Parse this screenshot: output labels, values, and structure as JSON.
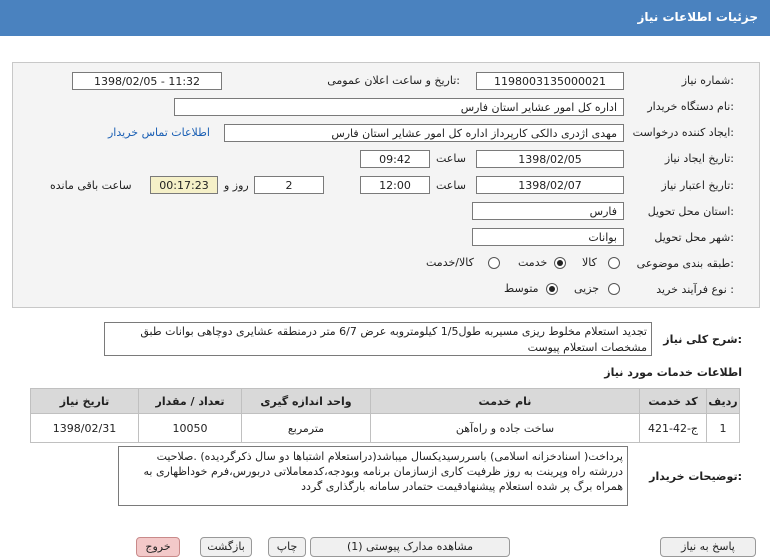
{
  "header": {
    "title": "جزئیات اطلاعات نیاز"
  },
  "form": {
    "need_number_label": "شماره نیاز:",
    "need_number": "1198003135000021",
    "announce_label": "تاریخ و ساعت اعلان عمومی:",
    "announce_value": "1398/02/05 - 11:32",
    "buyer_org_label": "نام دستگاه خریدار:",
    "buyer_org": "اداره کل امور عشایر استان فارس",
    "requester_label": "ایجاد کننده درخواست:",
    "requester": "مهدی اژدری دالکی  کارپرداز اداره کل امور عشایر استان فارس",
    "contact_link": "اطلاعات تماس خریدار",
    "created_label": "تاریخ ایجاد نیاز:",
    "created_date": "1398/02/05",
    "time_label": "ساعت",
    "created_time": "09:42",
    "validity_label": "تاریخ اعتبار نیاز:",
    "validity_date": "1398/02/07",
    "validity_time": "12:00",
    "days": "2",
    "day_label": "روز و",
    "remaining": "00:17:23",
    "remaining_label": "ساعت باقی مانده",
    "province_label": "استان محل تحویل:",
    "province": "فارس",
    "city_label": "شهر محل تحویل:",
    "city": "بوانات",
    "category_label": "طبقه بندی موضوعی:",
    "category_options": [
      "کالا",
      "خدمت",
      "کالا/خدمت"
    ],
    "category_selected": "خدمت",
    "process_label": "نوع فرآیند خرید :",
    "process_options": [
      "جزیی",
      "متوسط"
    ],
    "process_selected": "متوسط"
  },
  "description": {
    "label": "شرح کلی نیاز:",
    "text": "تجدید استعلام مخلوط ریزی مسیربه طول1/5 کیلومتروبه عرض 6/7 متر درمنطقه عشایری دوچاهی بوانات طبق مشخصات استعلام پیوست"
  },
  "services": {
    "title": "اطلاعات خدمات مورد نیاز",
    "columns": [
      "ردیف",
      "کد خدمت",
      "نام خدمت",
      "واحد اندازه گیری",
      "تعداد / مقدار",
      "تاریخ نیاز"
    ],
    "rows": [
      [
        "1",
        "ج-42-421",
        "ساخت جاده و راه‌آهن",
        "مترمربع",
        "10050",
        "1398/02/31"
      ]
    ]
  },
  "notes": {
    "label": "توضیحات خریدار:",
    "text": "پرداخت( اسنادخزانه اسلامی) باسررسیدیکسال میباشد(دراستعلام اشتباها دو سال ذکرگردیده) .صلاحیت دررشته راه وپرینت به روز ظرفیت کاری ازسازمان برنامه وبودجه،کدمعاملاتی دربورس،فرم خوداظهاری به همراه برگ پر شده استعلام پیشنهادقیمت حتمادر سامانه بارگذاری گردد"
  },
  "buttons": {
    "reply": "پاسخ به نیاز",
    "attachments": "مشاهده مدارک پیوستی (1)",
    "print": "چاپ",
    "back": "بازگشت",
    "exit": "خروج"
  }
}
